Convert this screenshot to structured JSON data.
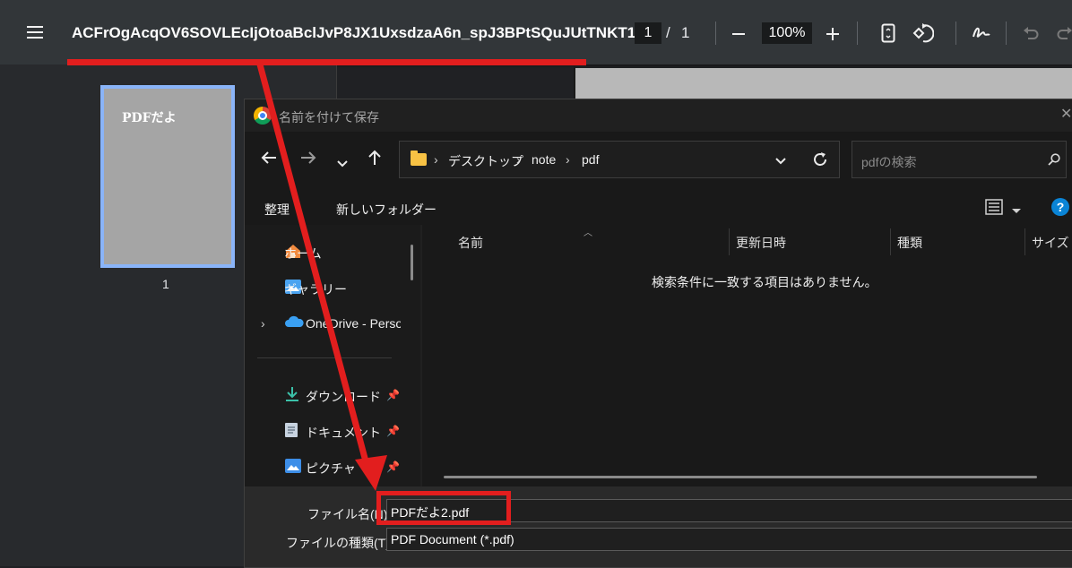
{
  "viewer": {
    "menu_icon": "hamburger-icon",
    "title": "ACFrOgAcqOV6SOVLEcIjOtoaBclJvP8JX1UxsdzaA6n_spJ3BPtSQuJUtTNKT1...",
    "page_current": "1",
    "page_separator": "/",
    "page_total": "1",
    "zoom": "100%",
    "icons": [
      "minus-icon",
      "plus-icon",
      "fit-page-icon",
      "rotate-icon",
      "draw-icon",
      "undo-icon",
      "redo-icon"
    ]
  },
  "thumbnails": {
    "page_text": "PDFだよ",
    "page_number": "1"
  },
  "dialog": {
    "title": "名前を付けて保存",
    "address": {
      "crumbs": [
        "デスクトップ",
        "note",
        "pdf"
      ]
    },
    "search_placeholder": "pdfの検索",
    "commands": {
      "organize": "整理",
      "new_folder": "新しいフォルダー"
    },
    "nav_items": [
      {
        "label": "ホーム",
        "icon": "home-icon"
      },
      {
        "label": "ギャラリー",
        "icon": "gallery-icon"
      },
      {
        "label": "OneDrive - Personal",
        "icon": "onedrive-icon"
      },
      {
        "label": "ダウンロード",
        "icon": "download-icon"
      },
      {
        "label": "ドキュメント",
        "icon": "document-icon"
      },
      {
        "label": "ピクチャ",
        "icon": "pictures-icon"
      }
    ],
    "columns": [
      "名前",
      "更新日時",
      "種類",
      "サイズ"
    ],
    "empty_message": "検索条件に一致する項目はありません。",
    "filename_label": "ファイル名(N):",
    "filename_value": "PDFだよ2.pdf",
    "filetype_label": "ファイルの種類(T):",
    "filetype_value": "PDF Document (*.pdf)"
  },
  "colors": {
    "annotation_red": "#e21e1e",
    "thumbnail_border": "#8ab4f8",
    "toolbar_bg": "#323639"
  }
}
